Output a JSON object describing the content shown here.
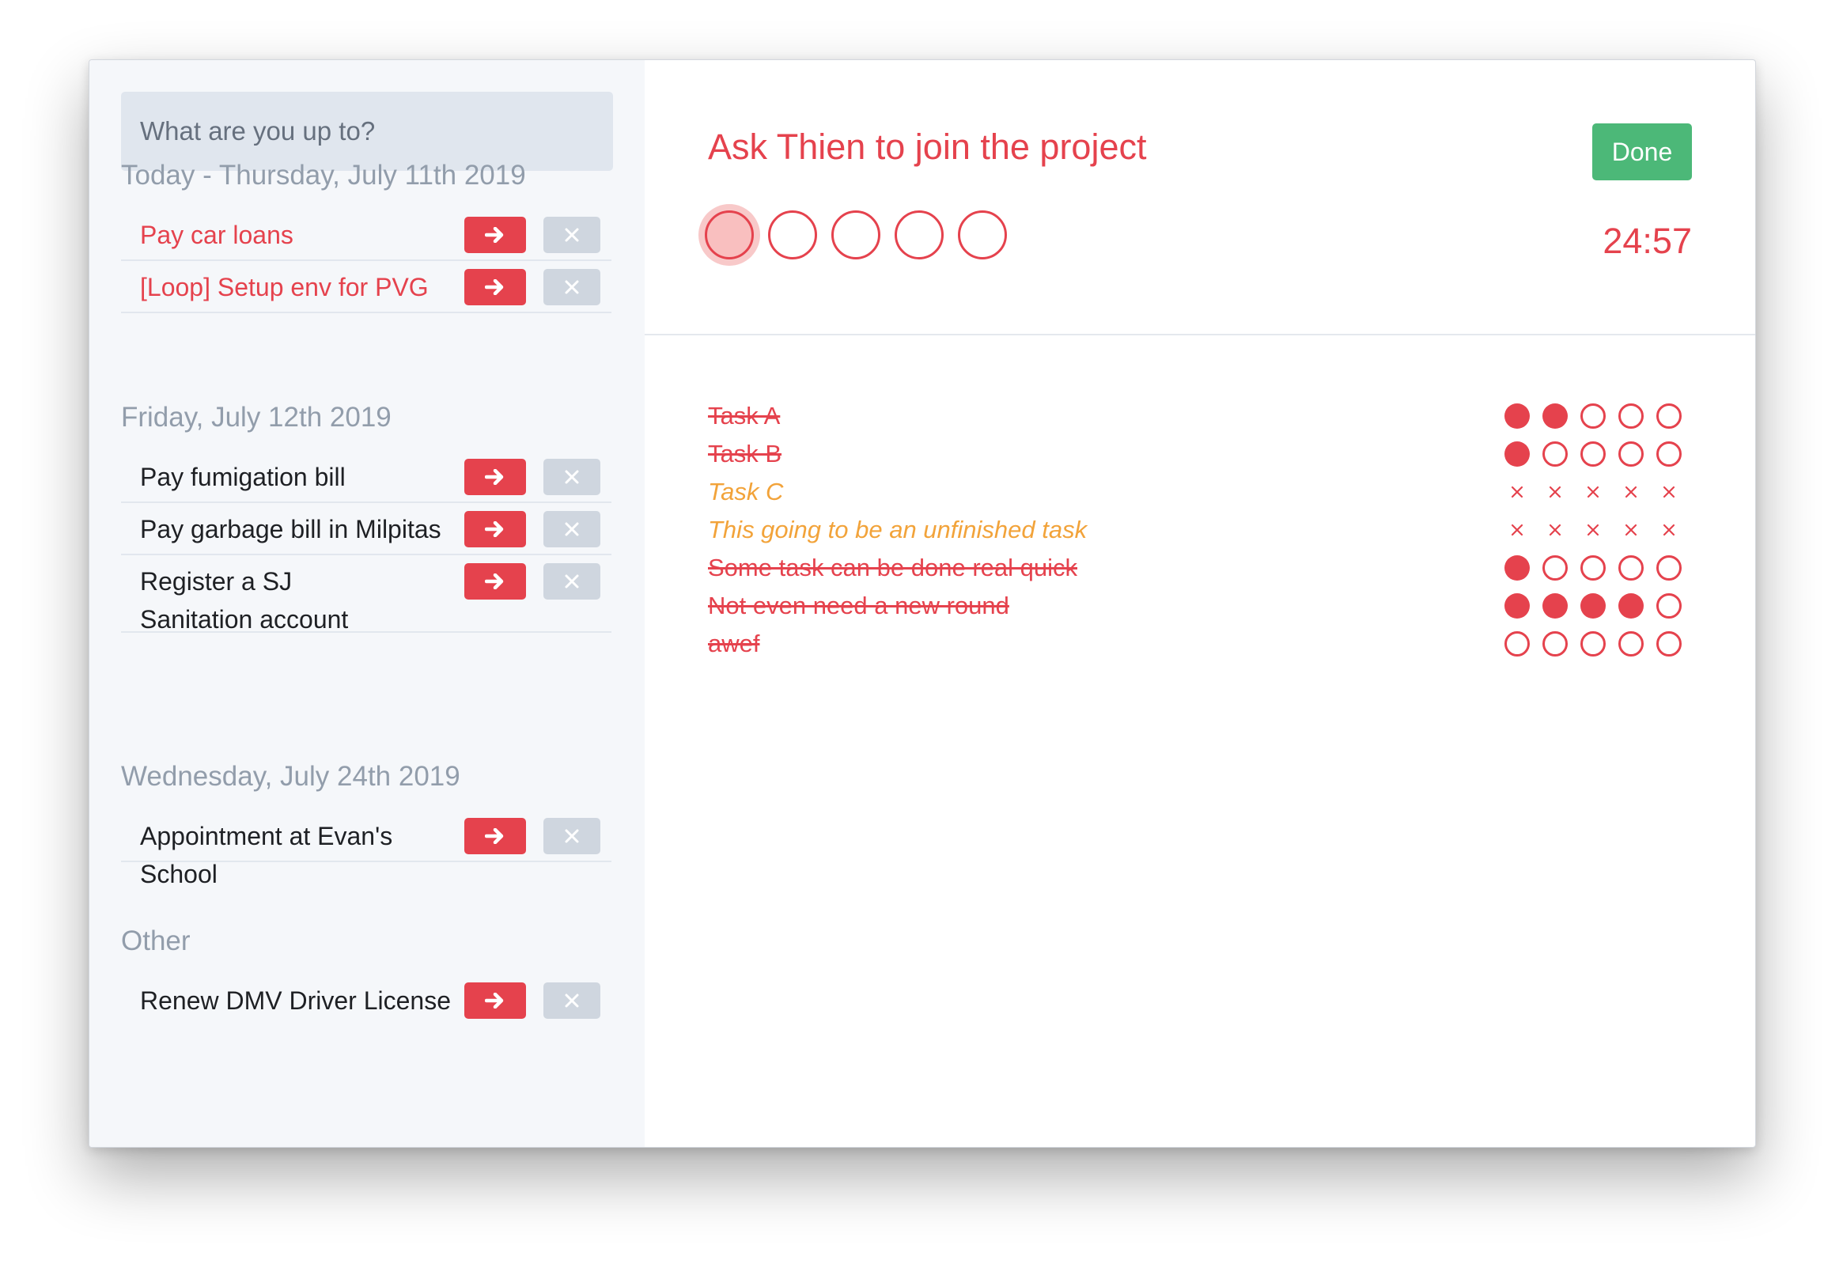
{
  "search": {
    "placeholder": "What are you up to?"
  },
  "groups": [
    {
      "title": "Today - Thursday, July 11th 2019",
      "items": [
        {
          "label": "Pay car loans",
          "highlight": true
        },
        {
          "label": "[Loop] Setup env for PVG",
          "highlight": true
        }
      ]
    },
    {
      "title": "Friday, July 12th 2019",
      "items": [
        {
          "label": "Pay fumigation bill",
          "highlight": false
        },
        {
          "label": "Pay garbage bill in Milpitas",
          "highlight": false
        },
        {
          "label": "Register a SJ Sanitation account",
          "highlight": false
        }
      ]
    },
    {
      "title": "Wednesday, July 24th 2019",
      "items": [
        {
          "label": "Appointment at Evan's School",
          "highlight": false
        }
      ]
    },
    {
      "title": "Other",
      "items": [
        {
          "label": "Renew DMV Driver License",
          "highlight": false
        }
      ]
    }
  ],
  "current_task": {
    "title": "Ask Thien to join the project",
    "done_label": "Done",
    "timer": "24:57",
    "pomodoro_total": 5,
    "pomodoro_active_index": 0
  },
  "history": [
    {
      "name": "Task A",
      "status": "done",
      "marks": [
        "full",
        "full",
        "empty",
        "empty",
        "empty"
      ]
    },
    {
      "name": "Task B",
      "status": "done",
      "marks": [
        "full",
        "empty",
        "empty",
        "empty",
        "empty"
      ]
    },
    {
      "name": "Task C",
      "status": "unfinished",
      "marks": [
        "skip",
        "skip",
        "skip",
        "skip",
        "skip"
      ]
    },
    {
      "name": "This going to be an unfinished task",
      "status": "unfinished",
      "marks": [
        "skip",
        "skip",
        "skip",
        "skip",
        "skip"
      ]
    },
    {
      "name": "Some task can be done real quick",
      "status": "done",
      "marks": [
        "full",
        "empty",
        "empty",
        "empty",
        "empty"
      ]
    },
    {
      "name": "Not even need a new round",
      "status": "done",
      "marks": [
        "full",
        "full",
        "full",
        "full",
        "empty"
      ]
    },
    {
      "name": "awef",
      "status": "done",
      "marks": [
        "empty",
        "empty",
        "empty",
        "empty",
        "empty"
      ]
    }
  ],
  "colors": {
    "accent_red": "#e5424d",
    "done_green": "#4cb878",
    "unfinished_orange": "#f2a33a",
    "sidebar_bg": "#f5f7fa",
    "group_title_gray": "#929dab"
  },
  "icons": {
    "start": "arrow-right-icon",
    "delete": "close-icon",
    "pomodoro": "circle-icon",
    "skipped": "cross-icon"
  }
}
